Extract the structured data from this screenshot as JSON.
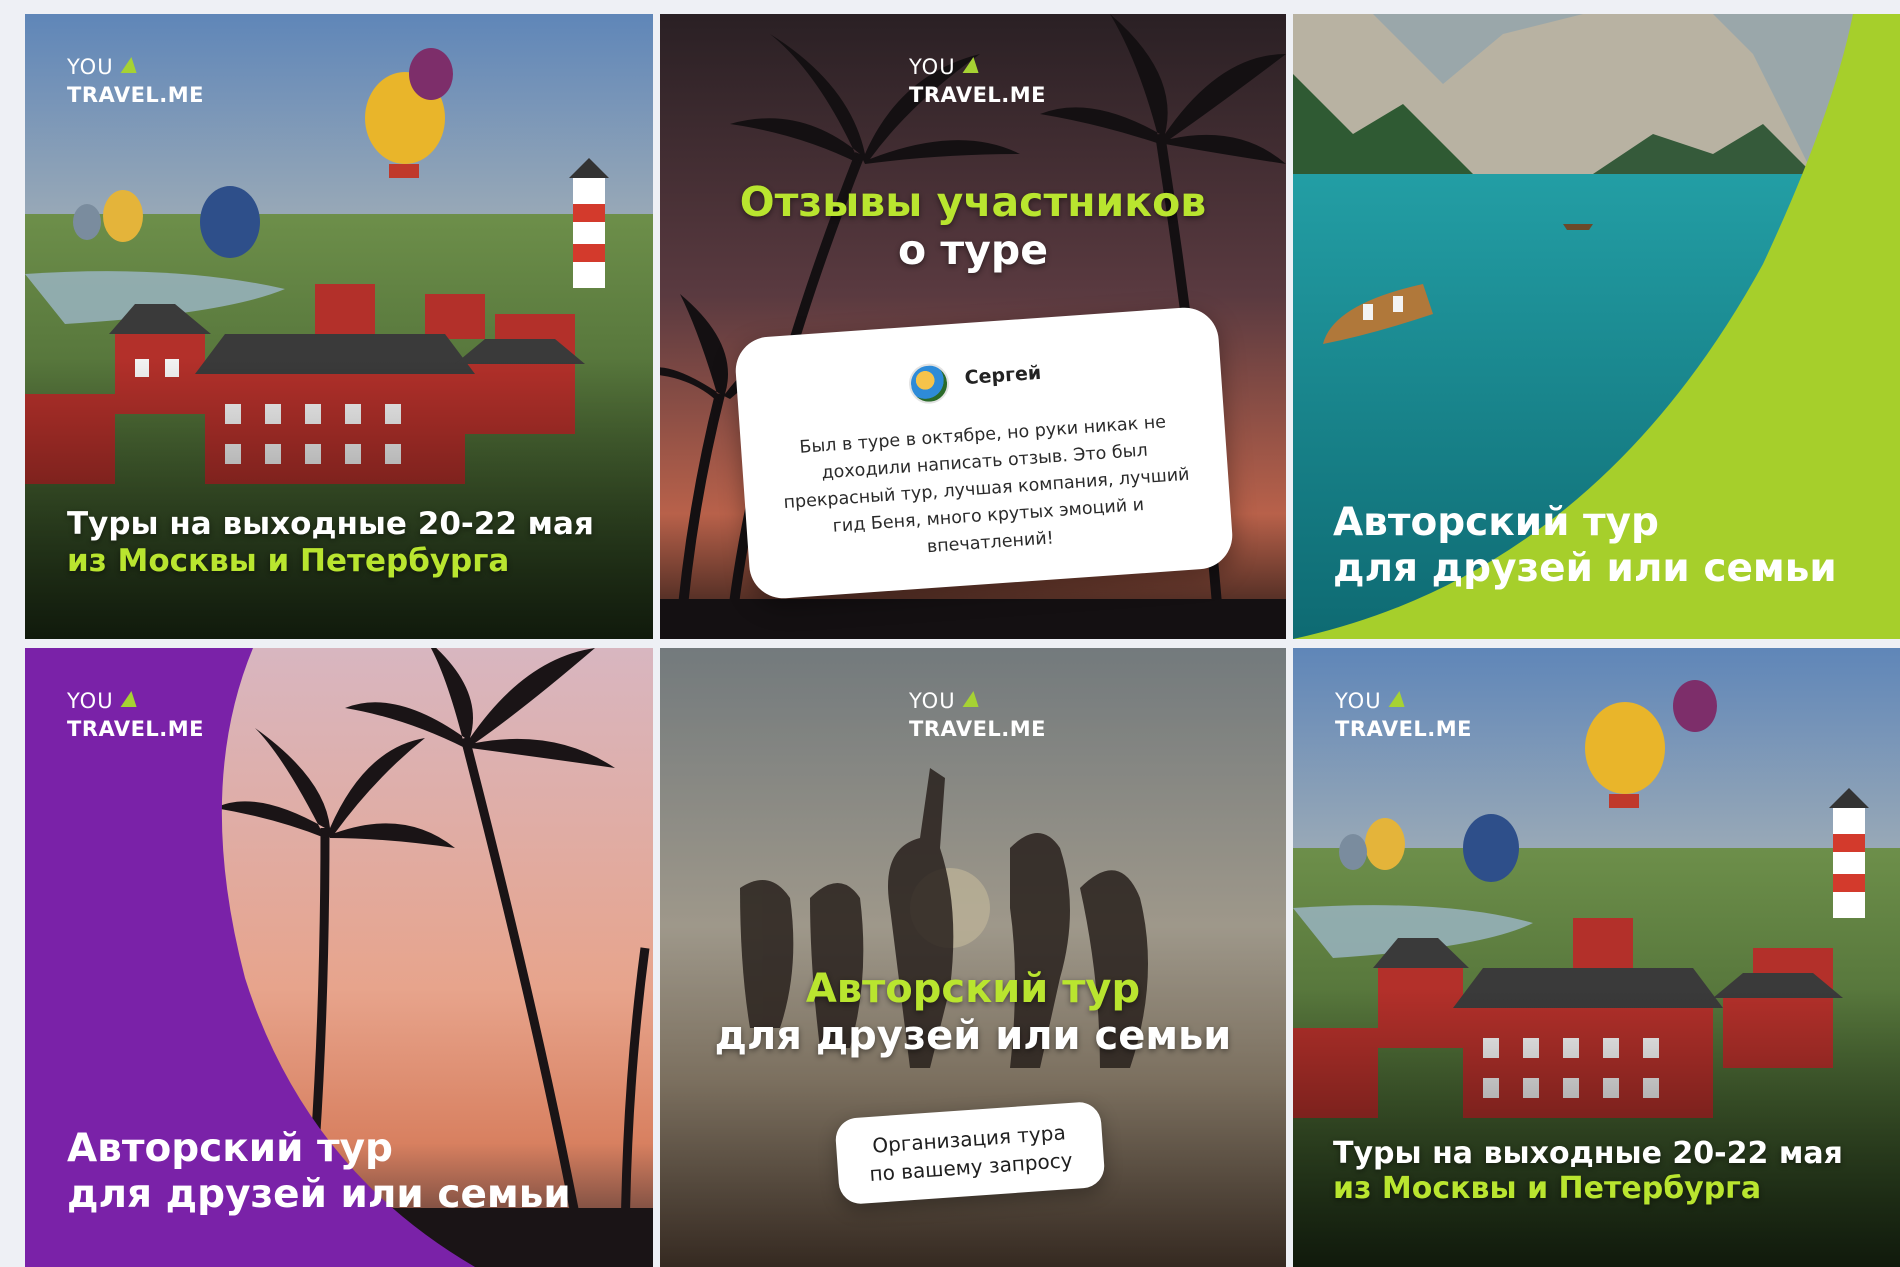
{
  "brand": {
    "you": "YOU",
    "travel": "TRAVEL.ME",
    "accent": "#a6d233",
    "headline_green": "#b9e52f",
    "purple": "#7a22a8"
  },
  "tiles": [
    {
      "id": "weekend-tours",
      "line1": "Туры на выходные 20-22 мая",
      "line2": "из Москвы и Петербурга"
    },
    {
      "id": "reviews",
      "title_line1": "Отзывы участников",
      "title_line2": "о туре",
      "review_name": "Сергей",
      "review_text": "Был в туре в октябре, но руки никак не доходили написать отзыв. Это был прекрасный тур, лучшая компания, лучший гид Беня, много крутых эмоций и впечатлений!"
    },
    {
      "id": "author-tour-lake",
      "line1": "Авторский тур",
      "line2": "для друзей или семьи"
    },
    {
      "id": "author-tour-palms",
      "line1": "Авторский тур",
      "line2": "для друзей или семьи"
    },
    {
      "id": "author-tour-friends",
      "line1": "Авторский тур",
      "line2": "для друзей или семьи",
      "pill_line1": "Организация тура",
      "pill_line2": "по вашему запросу"
    },
    {
      "id": "weekend-tours-2",
      "line1": "Туры на выходные 20-22 мая",
      "line2": "из Москвы и Петербурга"
    }
  ]
}
